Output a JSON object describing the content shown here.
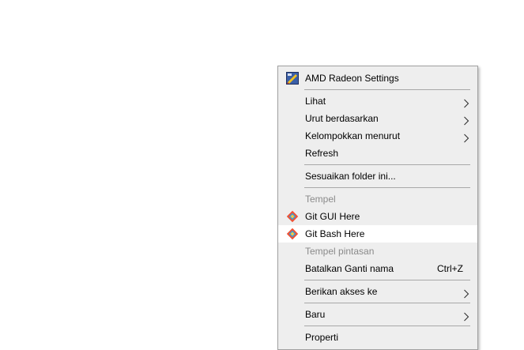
{
  "context_menu": {
    "items": [
      {
        "label": "AMD Radeon Settings",
        "icon": "amd-radeon-icon"
      },
      {
        "label": "Lihat",
        "submenu": true
      },
      {
        "label": "Urut berdasarkan",
        "submenu": true
      },
      {
        "label": "Kelompokkan menurut",
        "submenu": true
      },
      {
        "label": "Refresh"
      },
      {
        "label": "Sesuaikan folder ini..."
      },
      {
        "label": "Tempel",
        "disabled": true
      },
      {
        "label": "Git GUI Here",
        "icon": "git-icon"
      },
      {
        "label": "Git Bash Here",
        "icon": "git-icon",
        "highlighted": true
      },
      {
        "label": "Tempel pintasan",
        "disabled": true
      },
      {
        "label": "Batalkan Ganti nama",
        "shortcut": "Ctrl+Z"
      },
      {
        "label": "Berikan akses ke",
        "submenu": true
      },
      {
        "label": "Baru",
        "submenu": true
      },
      {
        "label": "Properti"
      }
    ]
  },
  "colors": {
    "menu_background": "#eeeeee",
    "highlight": "#ffffff",
    "disabled_text": "#8a8a8a",
    "separator": "#a8a8a8"
  }
}
